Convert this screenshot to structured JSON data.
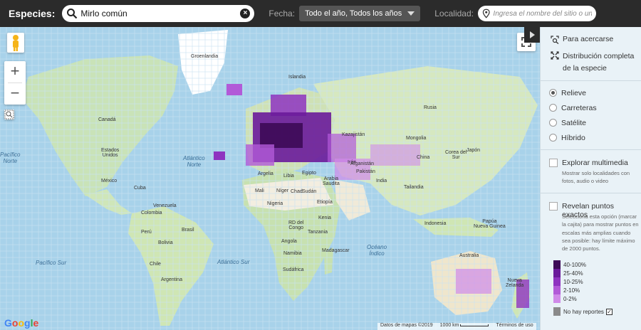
{
  "topbar": {
    "species_label": "Especies:",
    "search_value": "Mirlo común",
    "date_label": "Fecha:",
    "date_value": "Todo el año, Todos los años",
    "location_label": "Localidad:",
    "location_placeholder": "Ingresa el nombre del sitio o una"
  },
  "map": {
    "zoom_in": "+",
    "zoom_out": "−",
    "places": [
      {
        "t": "Groenlandia"
      },
      {
        "t": "Islandia"
      },
      {
        "t": "Canadá"
      },
      {
        "t": "Estados\nUnidos"
      },
      {
        "t": "México"
      },
      {
        "t": "Cuba"
      },
      {
        "t": "Venezuela"
      },
      {
        "t": "Colombia"
      },
      {
        "t": "Perú"
      },
      {
        "t": "Brasil"
      },
      {
        "t": "Bolivia"
      },
      {
        "t": "Chile"
      },
      {
        "t": "Argentina"
      },
      {
        "t": "Rusia"
      },
      {
        "t": "Kazajistán"
      },
      {
        "t": "Mongolia"
      },
      {
        "t": "China"
      },
      {
        "t": "Argelia"
      },
      {
        "t": "Libia"
      },
      {
        "t": "Egipto"
      },
      {
        "t": "Mali"
      },
      {
        "t": "Níger"
      },
      {
        "t": "Chad"
      },
      {
        "t": "Sudán"
      },
      {
        "t": "Nigeria"
      },
      {
        "t": "Etiopía"
      },
      {
        "t": "Kenia"
      },
      {
        "t": "RD del\nCongo"
      },
      {
        "t": "Angola"
      },
      {
        "t": "Tanzania"
      },
      {
        "t": "Namibia"
      },
      {
        "t": "Sudáfrica"
      },
      {
        "t": "Madagascar"
      },
      {
        "t": "Irán"
      },
      {
        "t": "Arabia\nSaudita"
      },
      {
        "t": "Afganistán"
      },
      {
        "t": "Pakistán"
      },
      {
        "t": "India"
      },
      {
        "t": "Tailandia"
      },
      {
        "t": "Indonesia"
      },
      {
        "t": "Papúa\nNueva Guinea"
      },
      {
        "t": "Australia"
      },
      {
        "t": "Japón"
      },
      {
        "t": "Corea del\nSur"
      },
      {
        "t": "Nueva\nZelanda"
      }
    ],
    "oceans": [
      {
        "t": "Pacífico\nNorte"
      },
      {
        "t": "Atlántico\nNorte"
      },
      {
        "t": "Pacífico Sur"
      },
      {
        "t": "Atlántico Sur"
      },
      {
        "t": "Océano\nÍndico"
      }
    ],
    "google_logo": "Google",
    "attribution": "Datos de mapas ©2019",
    "scale": "1000 km",
    "terms": "Términos de uso"
  },
  "panel": {
    "zoom_in_label": "Para acercarse",
    "full_dist_label": "Distribución completa de la especie",
    "map_types": [
      {
        "label": "Relieve",
        "selected": true
      },
      {
        "label": "Carreteras",
        "selected": false
      },
      {
        "label": "Satélite",
        "selected": false
      },
      {
        "label": "Híbrido",
        "selected": false
      }
    ],
    "multimedia_label": "Explorar multimedia",
    "multimedia_desc": "Mostrar solo localidades con fotos, audio o video",
    "exact_label": "Revelan puntos exactos",
    "exact_desc": "Selecciona esta opción (marcar la cajita) para mostrar puntos en escalas más amplias cuando sea posible: hay límite máximo de 2000 puntos."
  },
  "legend": {
    "entries": [
      {
        "label": "40-100%",
        "color": "#3d0a57"
      },
      {
        "label": "25-40%",
        "color": "#6a1b9a"
      },
      {
        "label": "10-25%",
        "color": "#8e34c0"
      },
      {
        "label": "2-10%",
        "color": "#b25ad8"
      },
      {
        "label": "0-2%",
        "color": "#d08ae9"
      }
    ],
    "no_reports_label": "No hay reportes",
    "no_reports_color": "#8a8a8a"
  }
}
